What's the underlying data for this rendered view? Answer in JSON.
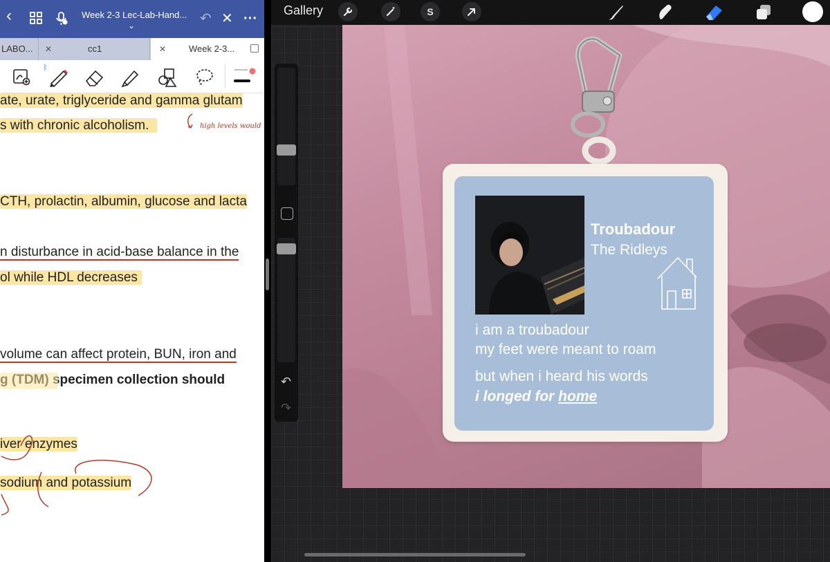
{
  "left_app": {
    "back_icon": "chevron-left-icon",
    "title": "Week 2-3 Lec-Lab-Hand...",
    "tabs": [
      {
        "label": "LABO..."
      },
      {
        "label": "cc1"
      },
      {
        "label": "Week 2-3..."
      }
    ],
    "tools": [
      "add-page-icon",
      "pen-icon",
      "eraser-icon",
      "highlighter-icon",
      "shapes-icon",
      "lasso-icon",
      "stroke-width-icon"
    ],
    "handwritten_note": "high levels would",
    "lines": [
      "ate, urate, triglyceride and gamma glutam",
      "s with chronic alcoholism.",
      "CTH, prolactin, albumin, glucose and lacta",
      "n disturbance in acid-base balance in the",
      "ol while HDL decreases",
      "volume can affect protein, BUN, iron and",
      "g (TDM) specimen collection should",
      "iver enzymes",
      "sodium and potassium"
    ]
  },
  "procreate": {
    "gallery_label": "Gallery",
    "colors": {
      "current": "#ffffff",
      "accent": "#2f7bf5"
    },
    "card": {
      "song_title": "Troubadour",
      "artist": "The Ridleys",
      "lyric_1": "i am a troubadour",
      "lyric_2": "my feet were meant to roam",
      "lyric_3": "but when i heard his words",
      "lyric_4a": "i longed for",
      "lyric_4b": "home"
    }
  }
}
